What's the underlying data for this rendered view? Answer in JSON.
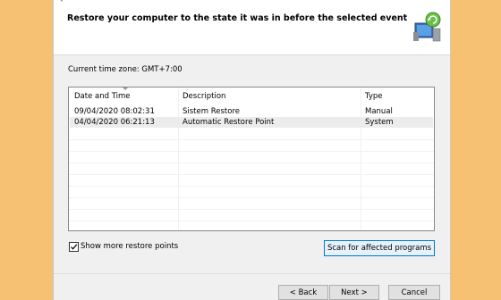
{
  "header": {
    "title": "Restore your computer to the state it was in before the selected event"
  },
  "timezone": {
    "label": "Current time zone: GMT+7:00"
  },
  "table": {
    "columns": [
      "Date and Time",
      "Description",
      "Type"
    ],
    "rows": [
      {
        "date": "09/04/2020 08:02:31",
        "description": "Sistem Restore",
        "type": "Manual"
      },
      {
        "date": "04/04/2020 06:21:13",
        "description": "Automatic Restore Point",
        "type": "System"
      }
    ]
  },
  "options": {
    "show_more_label": "Show more restore points",
    "show_more_checked": true,
    "scan_label": "Scan for affected programs"
  },
  "footer": {
    "back_label": "< Back",
    "next_label": "Next >",
    "cancel_label": "Cancel"
  },
  "icons": {
    "title": "system-restore-icon",
    "wizard": "system-restore-wizard-icon"
  }
}
